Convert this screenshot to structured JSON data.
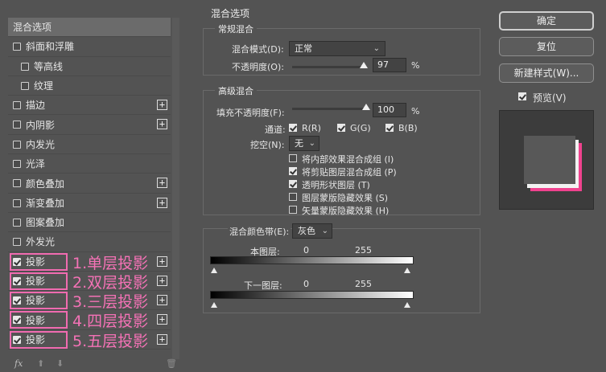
{
  "left_panel": {
    "items": [
      {
        "label": "混合选项",
        "checkbox": false,
        "checked": false,
        "plus": false,
        "indent": false,
        "selected": true
      },
      {
        "label": "斜面和浮雕",
        "checkbox": true,
        "checked": false,
        "plus": false,
        "indent": false
      },
      {
        "label": "等高线",
        "checkbox": true,
        "checked": false,
        "plus": false,
        "indent": true
      },
      {
        "label": "纹理",
        "checkbox": true,
        "checked": false,
        "plus": false,
        "indent": true
      },
      {
        "label": "描边",
        "checkbox": true,
        "checked": false,
        "plus": true,
        "indent": false
      },
      {
        "label": "内阴影",
        "checkbox": true,
        "checked": false,
        "plus": true,
        "indent": false
      },
      {
        "label": "内发光",
        "checkbox": true,
        "checked": false,
        "plus": false,
        "indent": false
      },
      {
        "label": "光泽",
        "checkbox": true,
        "checked": false,
        "plus": false,
        "indent": false
      },
      {
        "label": "颜色叠加",
        "checkbox": true,
        "checked": false,
        "plus": true,
        "indent": false
      },
      {
        "label": "渐变叠加",
        "checkbox": true,
        "checked": false,
        "plus": true,
        "indent": false
      },
      {
        "label": "图案叠加",
        "checkbox": true,
        "checked": false,
        "plus": false,
        "indent": false
      },
      {
        "label": "外发光",
        "checkbox": true,
        "checked": false,
        "plus": false,
        "indent": false
      },
      {
        "label": "投影",
        "checkbox": true,
        "checked": true,
        "plus": true,
        "indent": false,
        "annotation": "1.单层投影"
      },
      {
        "label": "投影",
        "checkbox": true,
        "checked": true,
        "plus": true,
        "indent": false,
        "annotation": "2.双层投影"
      },
      {
        "label": "投影",
        "checkbox": true,
        "checked": true,
        "plus": true,
        "indent": false,
        "annotation": "3.三层投影"
      },
      {
        "label": "投影",
        "checkbox": true,
        "checked": true,
        "plus": true,
        "indent": false,
        "annotation": "4.四层投影"
      },
      {
        "label": "投影",
        "checkbox": true,
        "checked": true,
        "plus": true,
        "indent": false,
        "annotation": "5.五层投影"
      }
    ],
    "bottom_icons": {
      "fx": "fx",
      "up": "⬆",
      "down": "⬇",
      "trash": "🗑"
    }
  },
  "center": {
    "title": "混合选项",
    "general": {
      "title": "常规混合",
      "blend_mode_label": "混合模式(D):",
      "blend_mode_value": "正常",
      "opacity_label": "不透明度(O):",
      "opacity_value": "97",
      "opacity_unit": "%",
      "opacity_level": 0.97
    },
    "advanced": {
      "title": "高级混合",
      "fill_label": "填充不透明度(F):",
      "fill_value": "100",
      "fill_unit": "%",
      "fill_level": 1.0,
      "channels_label": "通道:",
      "channel_r": "R(R)",
      "channel_g": "G(G)",
      "channel_b": "B(B)",
      "knockout_label": "挖空(N):",
      "knockout_value": "无",
      "options": [
        {
          "label": "将内部效果混合成组 (I)",
          "checked": false
        },
        {
          "label": "将剪贴图层混合成组 (P)",
          "checked": true
        },
        {
          "label": "透明形状图层 (T)",
          "checked": true
        },
        {
          "label": "图层蒙版隐藏效果 (S)",
          "checked": false
        },
        {
          "label": "矢量蒙版隐藏效果 (H)",
          "checked": false
        }
      ]
    },
    "blend_if": {
      "label": "混合颜色带(E):",
      "value": "灰色",
      "this_layer": "本图层:",
      "underlying": "下一图层:",
      "min": "0",
      "max": "255"
    }
  },
  "right": {
    "ok": "确定",
    "reset": "复位",
    "new_style": "新建样式(W)...",
    "preview_label": "预览(V)",
    "preview_checked": true
  },
  "colors": {
    "accent_pink": "#f472b6",
    "preview_pink": "#f0428e"
  }
}
